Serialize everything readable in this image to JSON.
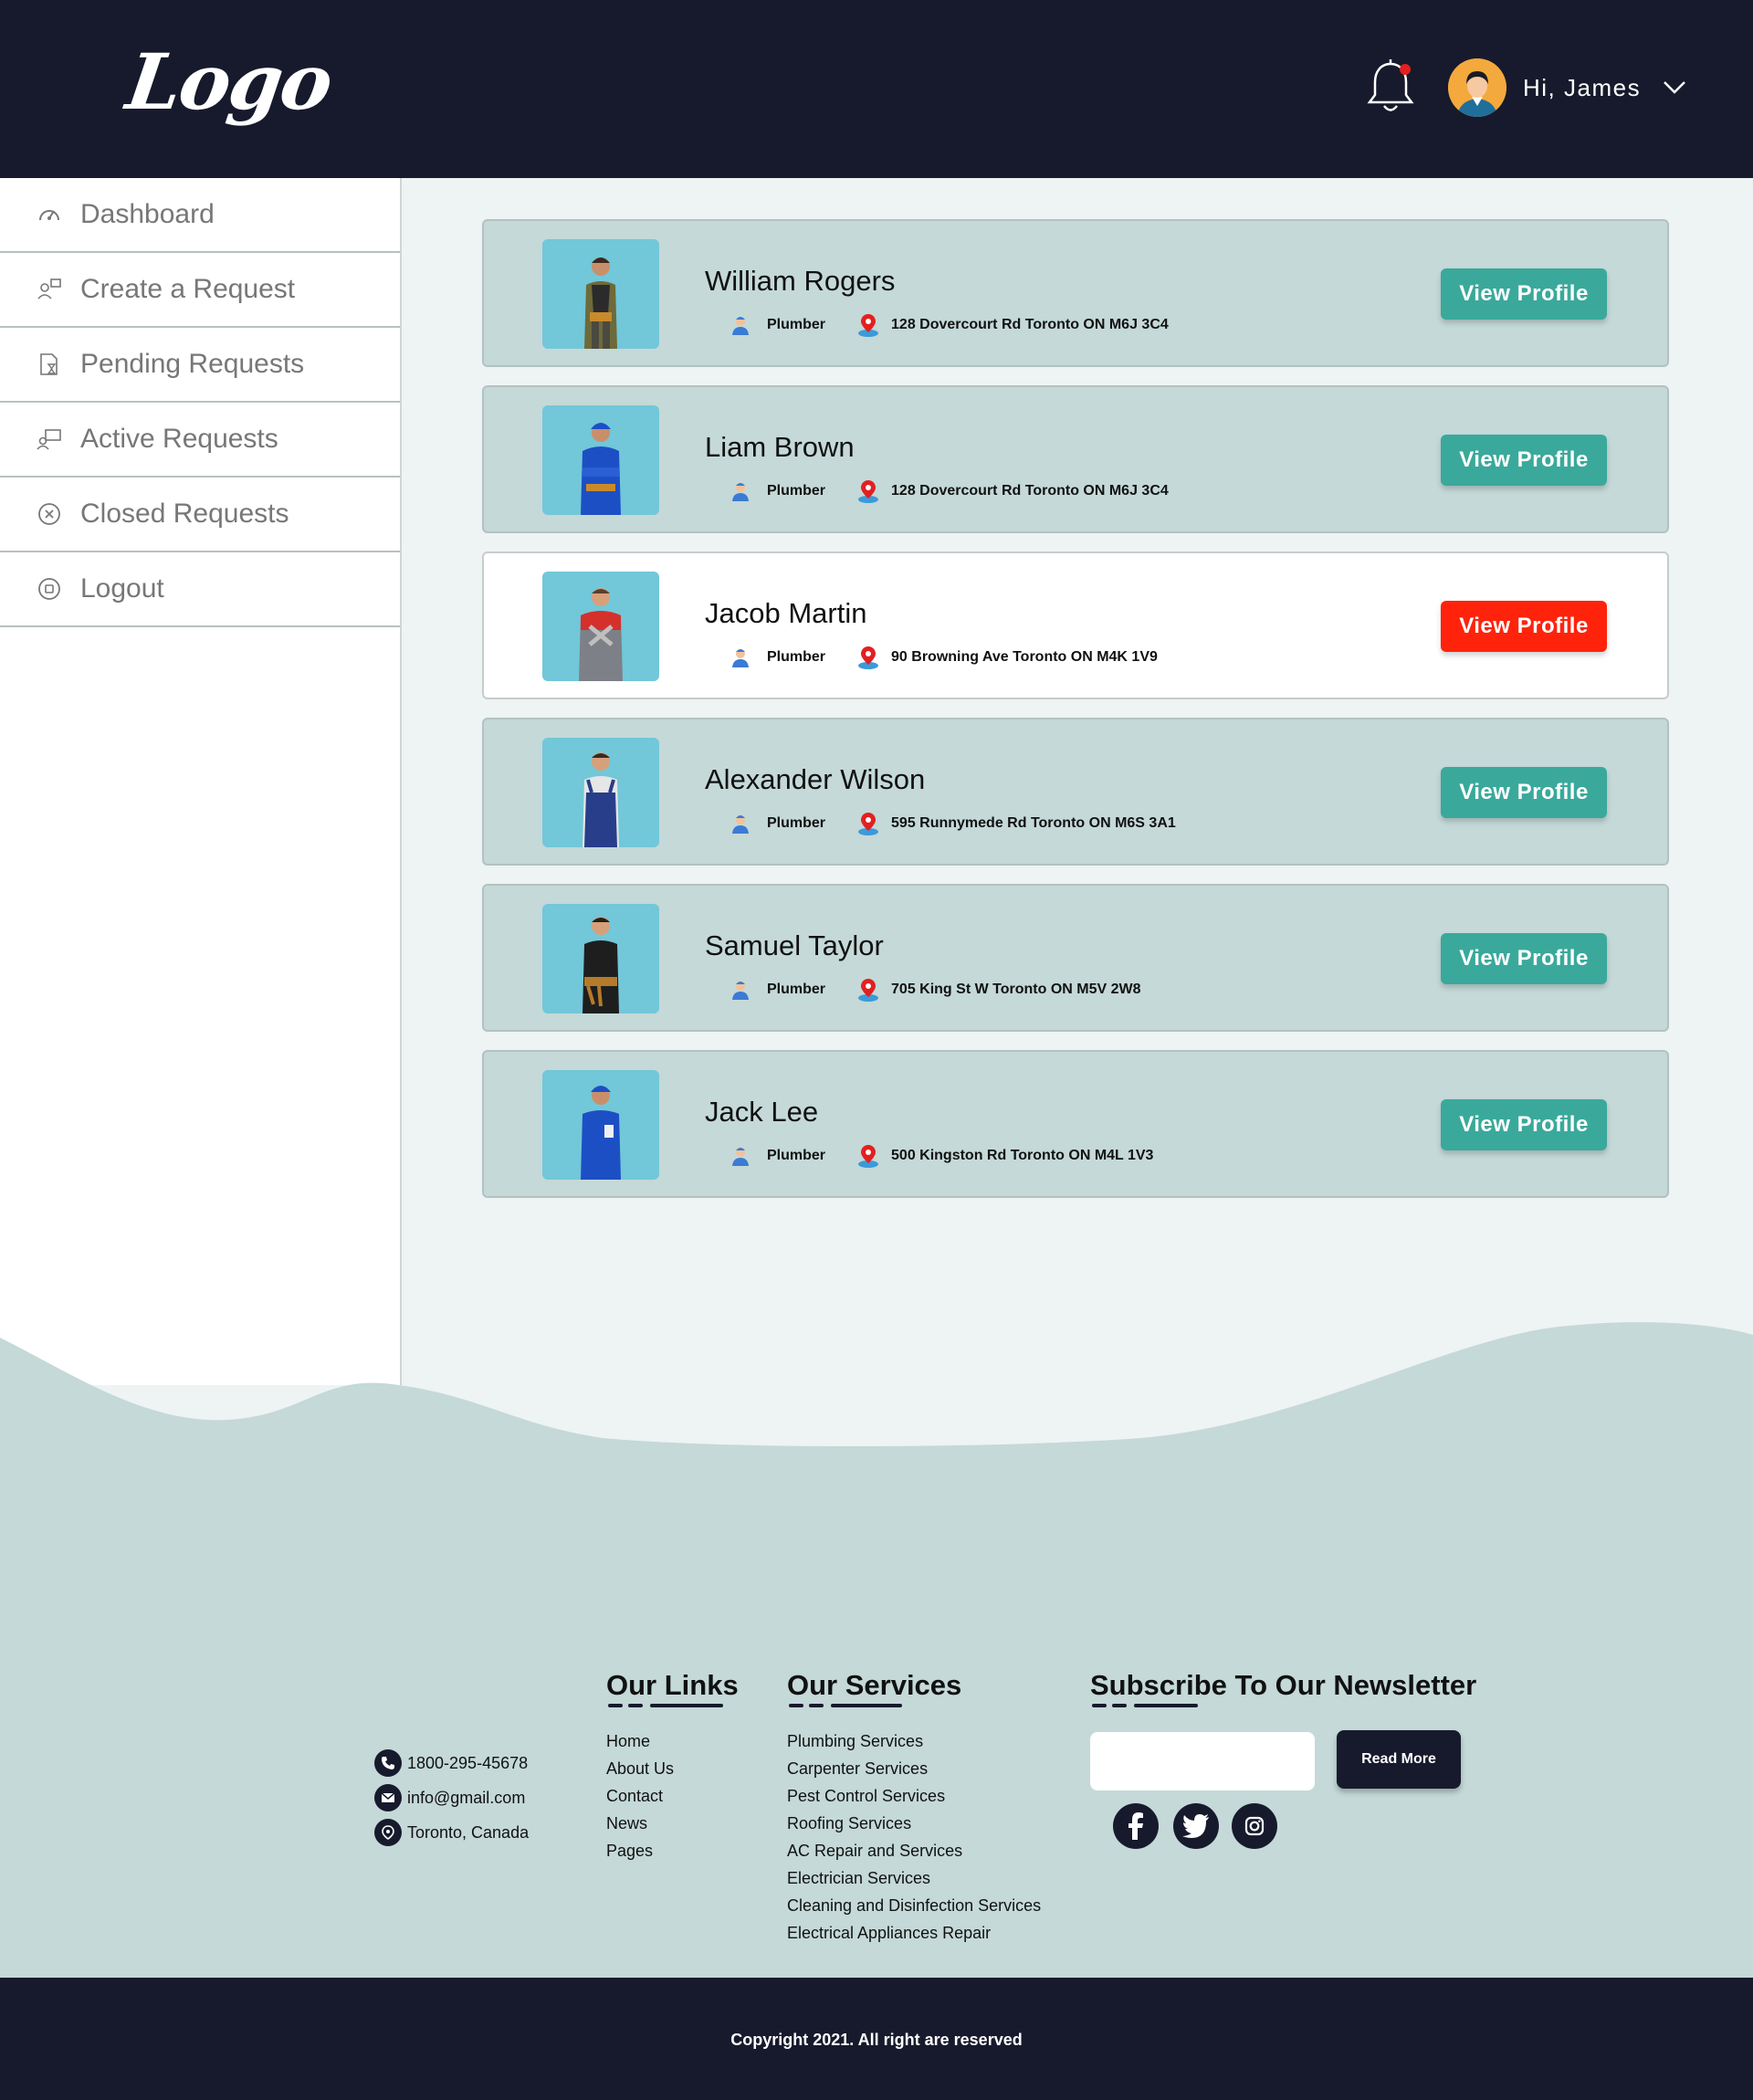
{
  "header": {
    "logo": "Logo",
    "greeting": "Hi, James"
  },
  "sidebar": {
    "items": [
      {
        "label": "Dashboard",
        "icon": "gauge-icon"
      },
      {
        "label": "Create a Request",
        "icon": "create-request-icon"
      },
      {
        "label": "Pending Requests",
        "icon": "pending-icon"
      },
      {
        "label": "Active Requests",
        "icon": "active-icon"
      },
      {
        "label": "Closed Requests",
        "icon": "close-circle-icon"
      },
      {
        "label": "Logout",
        "icon": "logout-icon"
      }
    ]
  },
  "providers": [
    {
      "name": "William Rogers",
      "role": "Plumber",
      "address": "128 Dovercourt Rd Toronto ON M6J 3C4",
      "button": "View Profile"
    },
    {
      "name": "Liam Brown",
      "role": "Plumber",
      "address": "128 Dovercourt Rd Toronto ON M6J 3C4",
      "button": "View Profile"
    },
    {
      "name": "Jacob Martin",
      "role": "Plumber",
      "address": "90 Browning Ave Toronto ON M4K 1V9",
      "button": "View Profile"
    },
    {
      "name": "Alexander Wilson",
      "role": "Plumber",
      "address": "595 Runnymede Rd Toronto ON M6S 3A1",
      "button": "View Profile"
    },
    {
      "name": "Samuel Taylor",
      "role": "Plumber",
      "address": "705 King St W Toronto ON M5V 2W8",
      "button": "View Profile"
    },
    {
      "name": "Jack Lee",
      "role": "Plumber",
      "address": "500 Kingston Rd Toronto ON M4L 1V3",
      "button": "View Profile"
    }
  ],
  "footer": {
    "contact": {
      "phone": "1800-295-45678",
      "email": "info@gmail.com",
      "location": "Toronto, Canada"
    },
    "links": {
      "title": "Our Links",
      "items": [
        "Home",
        "About Us",
        "Contact",
        "News",
        "Pages"
      ]
    },
    "services": {
      "title": "Our Services",
      "items": [
        "Plumbing Services",
        "Carpenter Services",
        "Pest Control Services",
        "Roofing Services",
        "AC Repair and Services",
        "Electrician Services",
        "Cleaning and Disinfection Services",
        "Electrical Appliances Repair"
      ]
    },
    "newsletter": {
      "title": "Subscribe To Our Newsletter",
      "input_value": "",
      "button": "Read More"
    },
    "copyright": "Copyright 2021. All right are reserved"
  },
  "colors": {
    "dark": "#171a2c",
    "teal": "#3aa99b",
    "active_button": "#ff230c",
    "card": "#c4d9d8",
    "photo_bg": "#72c7d9"
  }
}
